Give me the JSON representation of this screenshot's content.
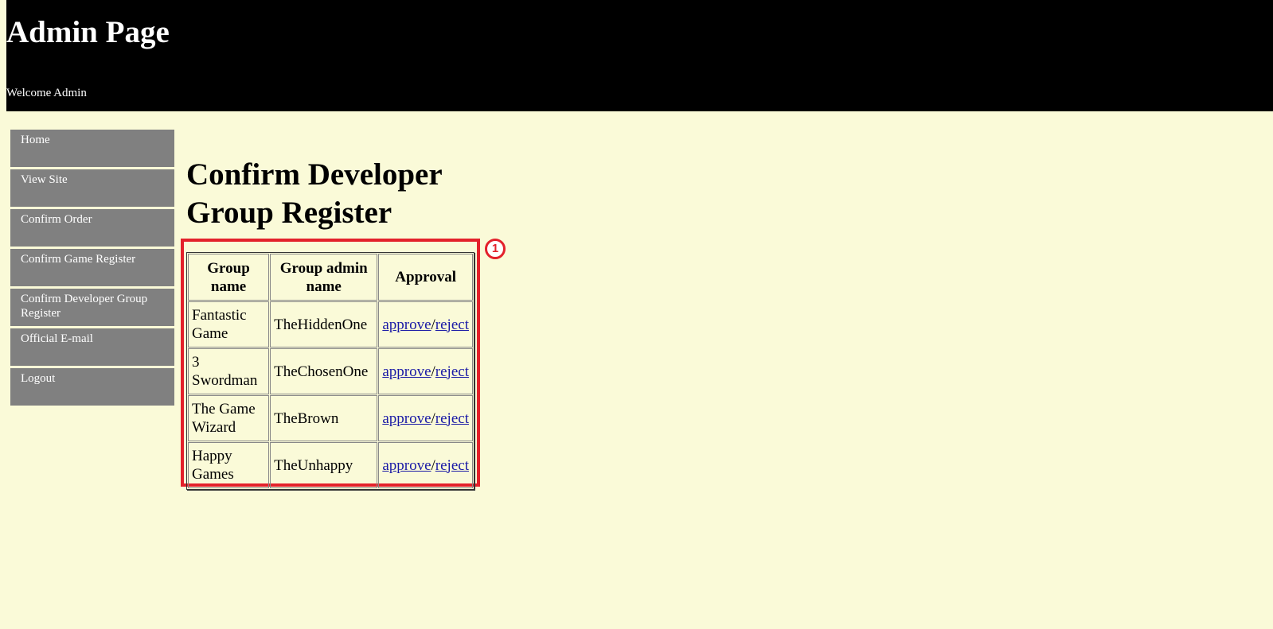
{
  "header": {
    "title": "Admin Page",
    "welcome": "Welcome Admin"
  },
  "sidebar": {
    "items": [
      {
        "label": "Home"
      },
      {
        "label": "View Site"
      },
      {
        "label": "Confirm Order"
      },
      {
        "label": "Confirm Game Register"
      },
      {
        "label": "Confirm Developer Group Register"
      },
      {
        "label": "Official E-mail"
      },
      {
        "label": "Logout"
      }
    ]
  },
  "main": {
    "title": "Confirm Developer Group Register",
    "annotation_marker": "1",
    "table": {
      "headers": [
        "Group name",
        "Group admin name",
        "Approval"
      ],
      "rows": [
        {
          "group_name": "Fantastic Game",
          "admin_name": "TheHiddenOne",
          "approve": "approve",
          "sep": "/",
          "reject": "reject"
        },
        {
          "group_name": "3 Swordman",
          "admin_name": "TheChosenOne",
          "approve": "approve",
          "sep": "/",
          "reject": "reject"
        },
        {
          "group_name": "The Game Wizard",
          "admin_name": "TheBrown",
          "approve": "approve",
          "sep": "/",
          "reject": "reject"
        },
        {
          "group_name": "Happy Games",
          "admin_name": "TheUnhappy",
          "approve": "approve",
          "sep": "/",
          "reject": "reject"
        }
      ]
    }
  },
  "colors": {
    "background": "#fafad8",
    "header_bg": "#000000",
    "nav_bg": "#808080",
    "link": "#1a1aa6",
    "highlight": "#e3212b"
  }
}
